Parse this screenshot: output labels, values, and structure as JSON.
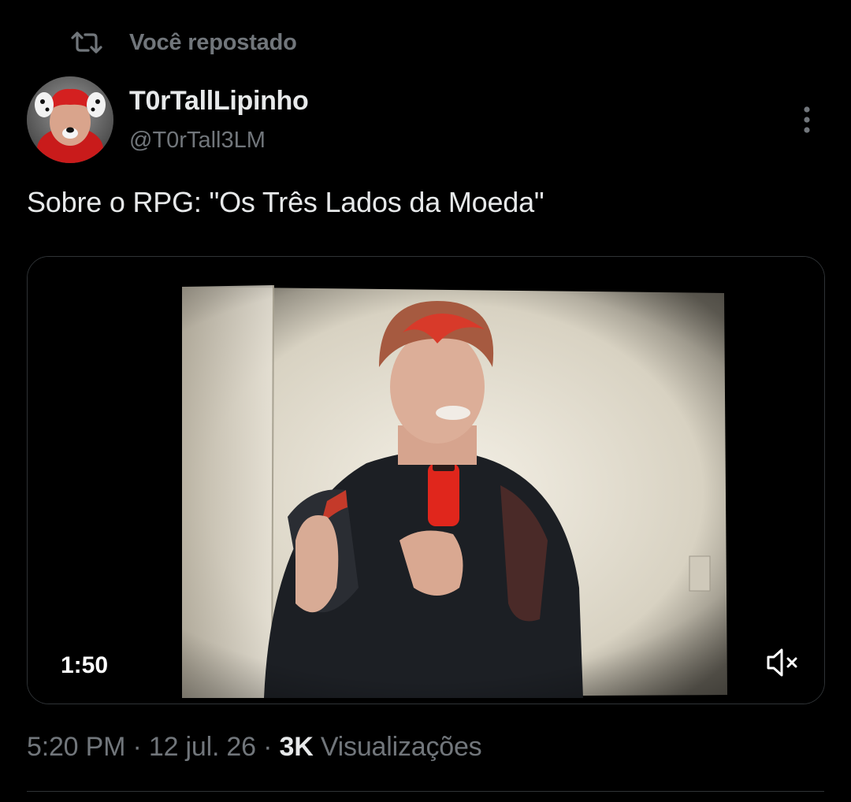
{
  "social_context": {
    "label": "Você repostado",
    "icon": "repost-icon"
  },
  "author": {
    "display_name": "T0rTallLipinho",
    "handle": "@T0rTall3LM",
    "avatar_icon": "avatar"
  },
  "tweet": {
    "text": "Sobre o RPG: \"Os Três Lados da Moeda\""
  },
  "media": {
    "type": "video",
    "duration": "1:50",
    "mute_icon": "volume-muted-icon"
  },
  "meta": {
    "time": "5:20 PM",
    "separator": "·",
    "date": "12 jul. 26",
    "views_count": "3K",
    "views_label": "Visualizações"
  },
  "colors": {
    "background": "#000000",
    "primary_text": "#e7e9ea",
    "secondary_text": "#71767b",
    "border": "#2f3336"
  }
}
